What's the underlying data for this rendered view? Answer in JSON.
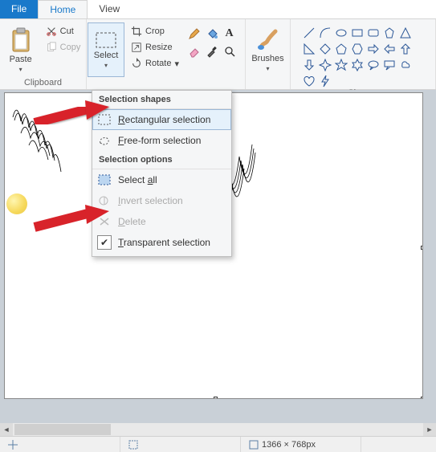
{
  "tabs": {
    "file": "File",
    "home": "Home",
    "view": "View"
  },
  "clipboard": {
    "label": "Clipboard",
    "paste": "Paste",
    "cut": "Cut",
    "copy": "Copy"
  },
  "image": {
    "select": "Select",
    "crop": "Crop",
    "resize": "Resize",
    "rotate": "Rotate"
  },
  "brushes": {
    "label": "Brushes"
  },
  "shapes": {
    "label": "Shapes"
  },
  "dropdown": {
    "section1": "Selection shapes",
    "rect": "Rectangular selection",
    "free": "Free-form selection",
    "section2": "Selection options",
    "all": "Select all",
    "invert": "Invert selection",
    "delete": "Delete",
    "transparent": "Transparent selection"
  },
  "status": {
    "dimensions": "1366 × 768px"
  }
}
